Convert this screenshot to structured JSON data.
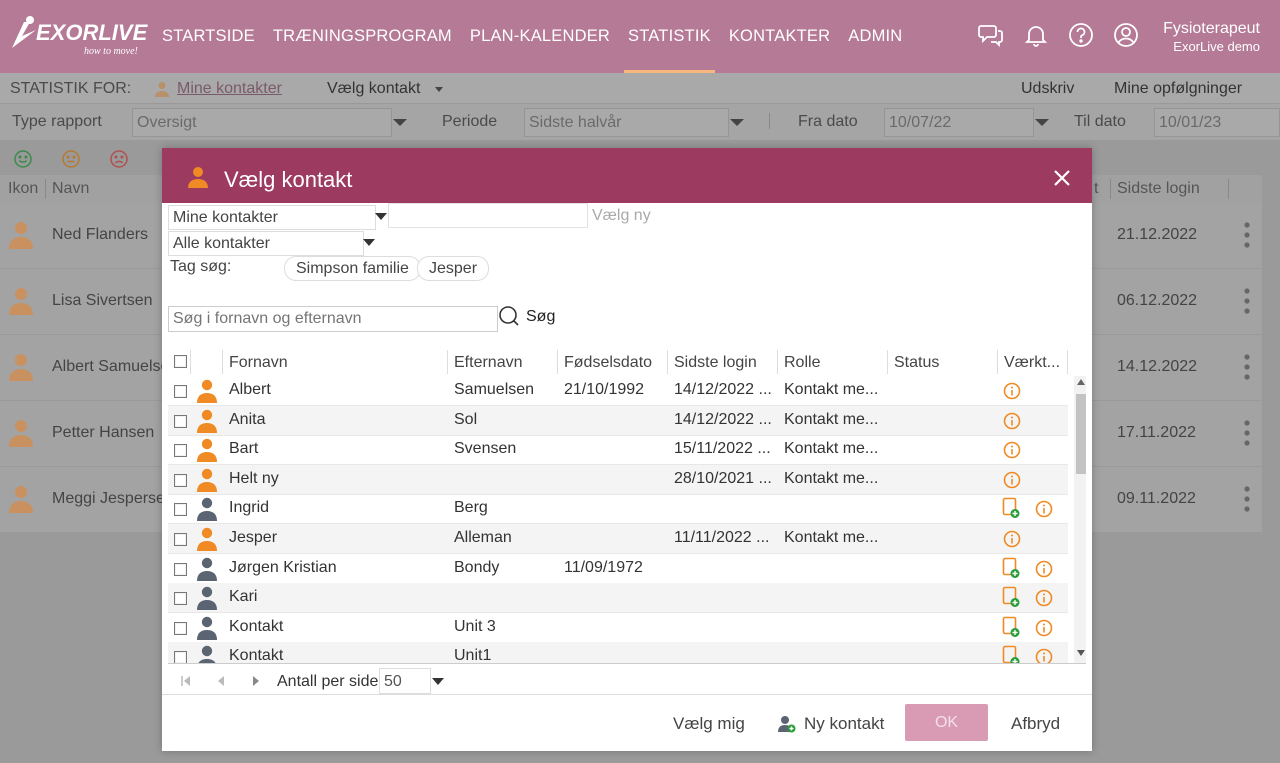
{
  "brand": {
    "logo_text": "EXORLIVE",
    "tagline": "how to move!"
  },
  "nav": {
    "items": [
      {
        "label": "STARTSIDE",
        "key": "startside"
      },
      {
        "label": "TRÆNINGSPROGRAM",
        "key": "traeningsprogram"
      },
      {
        "label": "PLAN-KALENDER",
        "key": "plan-kalender"
      },
      {
        "label": "STATISTIK",
        "key": "statistik",
        "active": true
      },
      {
        "label": "KONTAKTER",
        "key": "kontakter"
      },
      {
        "label": "ADMIN",
        "key": "admin"
      }
    ]
  },
  "user": {
    "name": "Fysioterapeut",
    "org": "ExorLive demo"
  },
  "subbar": {
    "stat_for_label": "STATISTIK FOR:",
    "my_contacts_link": "Mine kontakter",
    "choose_contact": "Vælg kontakt",
    "print": "Udskriv",
    "followups": "Mine opfølgninger"
  },
  "filters": {
    "report_type_label": "Type rapport",
    "report_type_value": "Oversigt",
    "period_label": "Periode",
    "period_value": "Sidste halvår",
    "from_label": "Fra dato",
    "from_value": "10/07/22",
    "to_label": "Til dato",
    "to_value": "10/01/23"
  },
  "bg_table": {
    "headers": {
      "icon": "Ikon",
      "name": "Navn",
      "last_login": "Sidste login",
      "cut": "t"
    },
    "rows": [
      {
        "name": "Ned Flanders",
        "date": "21.12.2022"
      },
      {
        "name": "Lisa Sivertsen",
        "date": "06.12.2022"
      },
      {
        "name": "Albert Samuelsen",
        "date": "14.12.2022"
      },
      {
        "name": "Petter Hansen",
        "date": "17.11.2022"
      },
      {
        "name": "Meggi Jespersen",
        "date": "09.11.2022"
      }
    ]
  },
  "modal": {
    "title": "Vælg kontakt",
    "contacts_select": "Mine kontakter",
    "all_select": "Alle kontakter",
    "choose_new": "Vælg ny",
    "tag_label": "Tag søg:",
    "tags": [
      "Simpson familie",
      "Jesper"
    ],
    "search_placeholder": "Søg i fornavn og efternavn",
    "search_button": "Søg",
    "columns": {
      "first": "Fornavn",
      "last": "Efternavn",
      "birth": "Fødselsdato",
      "last_login": "Sidste login",
      "role": "Rolle",
      "status": "Status",
      "tools": "Værkt..."
    },
    "rows": [
      {
        "first": "Albert",
        "last": "Samuelsen",
        "birth": "21/10/1992",
        "login": "14/12/2022 ...",
        "role": "Kontakt me...",
        "kind": "user",
        "add": false
      },
      {
        "first": "Anita",
        "last": "Sol",
        "birth": "",
        "login": "14/12/2022 ...",
        "role": "Kontakt me...",
        "kind": "user",
        "add": false
      },
      {
        "first": "Bart",
        "last": "Svensen",
        "birth": "",
        "login": "15/11/2022 ...",
        "role": "Kontakt me...",
        "kind": "user",
        "add": false
      },
      {
        "first": "Helt ny",
        "last": "",
        "birth": "",
        "login": "28/10/2021 ...",
        "role": "Kontakt me...",
        "kind": "user",
        "add": false
      },
      {
        "first": "Ingrid",
        "last": "Berg",
        "birth": "",
        "login": "",
        "role": "",
        "kind": "contact",
        "add": true
      },
      {
        "first": "Jesper",
        "last": "Alleman",
        "birth": "",
        "login": "11/11/2022 ...",
        "role": "Kontakt me...",
        "kind": "user",
        "add": false
      },
      {
        "first": "Jørgen Kristian",
        "last": "Bondy",
        "birth": "11/09/1972",
        "login": "",
        "role": "",
        "kind": "contact",
        "add": true
      },
      {
        "first": "Kari",
        "last": "",
        "birth": "",
        "login": "",
        "role": "",
        "kind": "contact",
        "add": true
      },
      {
        "first": "Kontakt",
        "last": "Unit 3",
        "birth": "",
        "login": "",
        "role": "",
        "kind": "contact",
        "add": true
      },
      {
        "first": "Kontakt",
        "last": "Unit1",
        "birth": "",
        "login": "",
        "role": "",
        "kind": "contact",
        "add": true
      }
    ],
    "pager": {
      "per_page_label": "Antall per side",
      "per_page_value": "50"
    },
    "footer": {
      "choose_me": "Vælg mig",
      "new_contact": "Ny kontakt",
      "ok": "OK",
      "cancel": "Afbryd"
    }
  },
  "colors": {
    "nav_bg": "#b57a95",
    "modal_header": "#9c3a5f",
    "accent_orange": "#f08a24",
    "contact_gray": "#5a6472",
    "ok_disabled": "#d99bb3",
    "add_green": "#2a9d3a"
  }
}
